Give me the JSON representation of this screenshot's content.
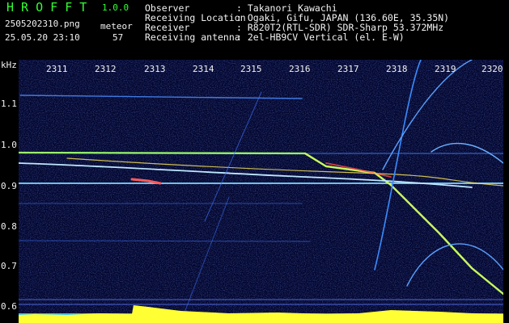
{
  "header": {
    "logo": "H R O F F T",
    "version": "1.0.0",
    "filename": "2505202310.png",
    "timestamp": "25.05.20 23:10",
    "count_label": "meteor",
    "count_value": "57",
    "info": [
      {
        "key": "Observer",
        "value": ": Takanori Kawachi"
      },
      {
        "key": "Receiving Location",
        "value": ": Ogaki, Gifu, JAPAN (136.60E, 35.35N)"
      },
      {
        "key": "Receiver",
        "value": ": R820T2(RTL-SDR) SDR-Sharp 53.372MHz"
      },
      {
        "key": "Receiving antenna",
        "value": ": 2el-HB9CV Vertical (el. E-W)"
      }
    ]
  },
  "axis": {
    "y_unit": "kHz",
    "y_ticks": [
      "1.1",
      "1.0",
      "0.9",
      "0.8",
      "0.7",
      "0.6"
    ],
    "x_ticks": [
      "2311",
      "2312",
      "2313",
      "2314",
      "2315",
      "2316",
      "2317",
      "2318",
      "2319",
      "2320"
    ]
  },
  "colors": {
    "background": "#000000",
    "spectrogram_bg": "#03072e",
    "header_text": "#f2f2f2",
    "accent_green": "#33ff33",
    "level_bar": "#ffff33",
    "level_base": "#39c6f0"
  }
}
